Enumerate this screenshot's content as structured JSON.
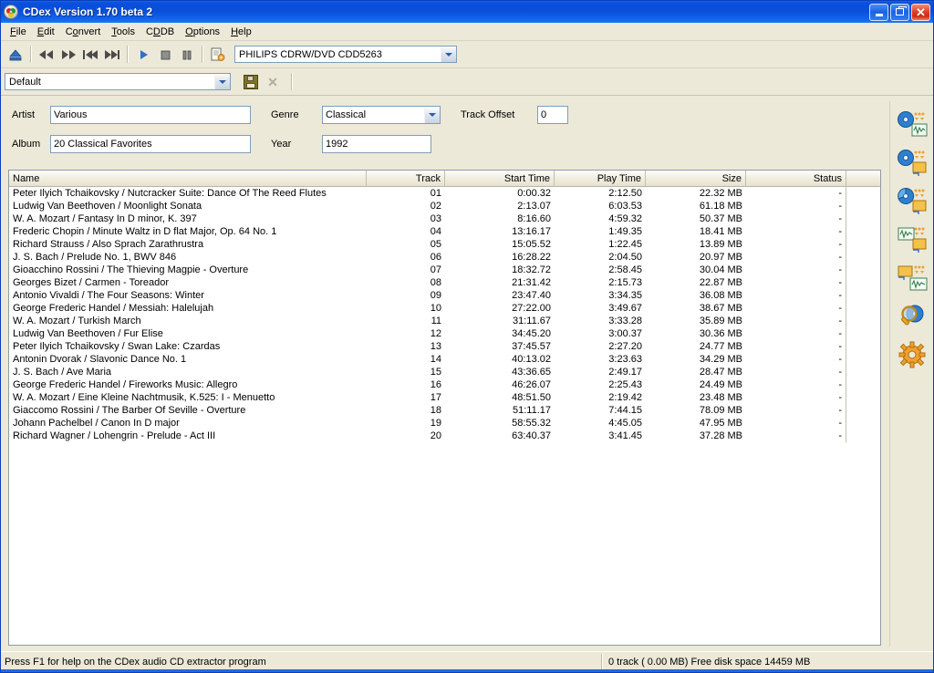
{
  "window": {
    "title": "CDex Version 1.70 beta 2",
    "icon": "cd-disc-icon",
    "buttons": {
      "minimize": "minimize-button",
      "maximize": "restore-button",
      "close": "close-button"
    }
  },
  "menubar": {
    "items": [
      {
        "label": "File",
        "accel": "F"
      },
      {
        "label": "Edit",
        "accel": "E"
      },
      {
        "label": "Convert",
        "accel": "C"
      },
      {
        "label": "Tools",
        "accel": "T"
      },
      {
        "label": "CDDB",
        "accel": "D"
      },
      {
        "label": "Options",
        "accel": "O"
      },
      {
        "label": "Help",
        "accel": "H"
      }
    ]
  },
  "toolbar": {
    "buttons": [
      {
        "name": "eject-button",
        "icon": "eject-icon"
      },
      {
        "name": "rewind-button",
        "icon": "rewind-icon"
      },
      {
        "name": "fast-forward-button",
        "icon": "fast-forward-icon"
      },
      {
        "name": "previous-track-button",
        "icon": "previous-track-icon"
      },
      {
        "name": "next-track-button",
        "icon": "next-track-icon"
      },
      {
        "name": "play-button",
        "icon": "play-icon"
      },
      {
        "name": "stop-button",
        "icon": "stop-icon"
      },
      {
        "name": "pause-button",
        "icon": "pause-icon"
      },
      {
        "name": "cddb-settings-button",
        "icon": "document-gear-icon"
      }
    ],
    "drive": {
      "label": "drive-selector",
      "value": "PHILIPS CDRW/DVD CDD5263"
    }
  },
  "profile_bar": {
    "profile": {
      "value": "Default"
    },
    "save_label": "save-profile-button",
    "delete_label": "delete-profile-button",
    "delete_glyph": "✕"
  },
  "metadata": {
    "artist_label": "Artist",
    "artist_value": "Various",
    "album_label": "Album",
    "album_value": "20 Classical Favorites",
    "genre_label": "Genre",
    "genre_value": "Classical",
    "year_label": "Year",
    "year_value": "1992",
    "track_offset_label": "Track Offset",
    "track_offset_value": "0"
  },
  "tracklist": {
    "columns": [
      {
        "key": "name",
        "label": "Name",
        "align": "l"
      },
      {
        "key": "track",
        "label": "Track",
        "align": "r"
      },
      {
        "key": "start",
        "label": "Start Time",
        "align": "r"
      },
      {
        "key": "play",
        "label": "Play Time",
        "align": "r"
      },
      {
        "key": "size",
        "label": "Size",
        "align": "r"
      },
      {
        "key": "status",
        "label": "Status",
        "align": "r"
      }
    ],
    "rows": [
      {
        "name": "Peter Ilyich Tchaikovsky / Nutcracker Suite: Dance Of The Reed Flutes",
        "track": "01",
        "start": "0:00.32",
        "play": "2:12.50",
        "size": "22.32 MB",
        "status": "-"
      },
      {
        "name": "Ludwig Van Beethoven / Moonlight Sonata",
        "track": "02",
        "start": "2:13.07",
        "play": "6:03.53",
        "size": "61.18 MB",
        "status": "-"
      },
      {
        "name": "W. A. Mozart / Fantasy In D minor, K. 397",
        "track": "03",
        "start": "8:16.60",
        "play": "4:59.32",
        "size": "50.37 MB",
        "status": "-"
      },
      {
        "name": "Frederic Chopin / Minute Waltz in D flat Major, Op. 64 No. 1",
        "track": "04",
        "start": "13:16.17",
        "play": "1:49.35",
        "size": "18.41 MB",
        "status": "-"
      },
      {
        "name": "Richard Strauss / Also Sprach Zarathrustra",
        "track": "05",
        "start": "15:05.52",
        "play": "1:22.45",
        "size": "13.89 MB",
        "status": "-"
      },
      {
        "name": "J. S. Bach / Prelude No. 1, BWV 846",
        "track": "06",
        "start": "16:28.22",
        "play": "2:04.50",
        "size": "20.97 MB",
        "status": "-"
      },
      {
        "name": "Gioacchino Rossini / The Thieving Magpie - Overture",
        "track": "07",
        "start": "18:32.72",
        "play": "2:58.45",
        "size": "30.04 MB",
        "status": "-"
      },
      {
        "name": "Georges Bizet / Carmen - Toreador",
        "track": "08",
        "start": "21:31.42",
        "play": "2:15.73",
        "size": "22.87 MB",
        "status": "-"
      },
      {
        "name": "Antonio Vivaldi / The Four Seasons: Winter",
        "track": "09",
        "start": "23:47.40",
        "play": "3:34.35",
        "size": "36.08 MB",
        "status": "-"
      },
      {
        "name": "George Frederic Handel / Messiah: Halelujah",
        "track": "10",
        "start": "27:22.00",
        "play": "3:49.67",
        "size": "38.67 MB",
        "status": "-"
      },
      {
        "name": "W. A. Mozart / Turkish March",
        "track": "11",
        "start": "31:11.67",
        "play": "3:33.28",
        "size": "35.89 MB",
        "status": "-"
      },
      {
        "name": "Ludwig Van Beethoven / Fur Elise",
        "track": "12",
        "start": "34:45.20",
        "play": "3:00.37",
        "size": "30.36 MB",
        "status": "-"
      },
      {
        "name": "Peter Ilyich Tchaikovsky / Swan Lake: Czardas",
        "track": "13",
        "start": "37:45.57",
        "play": "2:27.20",
        "size": "24.77 MB",
        "status": "-"
      },
      {
        "name": "Antonin Dvorak / Slavonic Dance No. 1",
        "track": "14",
        "start": "40:13.02",
        "play": "3:23.63",
        "size": "34.29 MB",
        "status": "-"
      },
      {
        "name": "J. S. Bach / Ave Maria",
        "track": "15",
        "start": "43:36.65",
        "play": "2:49.17",
        "size": "28.47 MB",
        "status": "-"
      },
      {
        "name": "George Frederic Handel / Fireworks Music: Allegro",
        "track": "16",
        "start": "46:26.07",
        "play": "2:25.43",
        "size": "24.49 MB",
        "status": "-"
      },
      {
        "name": "W. A. Mozart / Eine Kleine Nachtmusik, K.525: I - Menuetto",
        "track": "17",
        "start": "48:51.50",
        "play": "2:19.42",
        "size": "23.48 MB",
        "status": "-"
      },
      {
        "name": "Giaccomo Rossini / The Barber Of Seville - Overture",
        "track": "18",
        "start": "51:11.17",
        "play": "7:44.15",
        "size": "78.09 MB",
        "status": "-"
      },
      {
        "name": "Johann Pachelbel / Canon In D major",
        "track": "19",
        "start": "58:55.32",
        "play": "4:45.05",
        "size": "47.95 MB",
        "status": "-"
      },
      {
        "name": "Richard Wagner / Lohengrin - Prelude - Act III",
        "track": "20",
        "start": "63:40.37",
        "play": "3:41.45",
        "size": "37.28 MB",
        "status": "-"
      }
    ]
  },
  "rail": {
    "buttons": [
      {
        "name": "extract-cd-to-wav-button",
        "icon": "cd-to-wave-icon"
      },
      {
        "name": "extract-cd-to-compressed-button",
        "icon": "cd-to-file-icon"
      },
      {
        "name": "extract-partial-cd-button",
        "icon": "cd-partial-to-file-icon"
      },
      {
        "name": "convert-wav-to-compressed-button",
        "icon": "wave-to-file-icon"
      },
      {
        "name": "convert-compressed-to-wav-button",
        "icon": "file-to-wave-icon"
      },
      {
        "name": "cd-info-button",
        "icon": "magnifier-cd-icon"
      },
      {
        "name": "settings-button",
        "icon": "gear-icon"
      }
    ]
  },
  "statusbar": {
    "hint": "Press F1 for help on the CDex audio CD extractor program",
    "info": "0 track ( 0.00 MB) Free disk space 14459 MB"
  },
  "colors": {
    "window_face": "#ece9d8",
    "title_blue": "#0a4ed8",
    "close_red": "#e0412a",
    "field_border": "#7f9db9",
    "accent_orange": "#f0a030"
  }
}
